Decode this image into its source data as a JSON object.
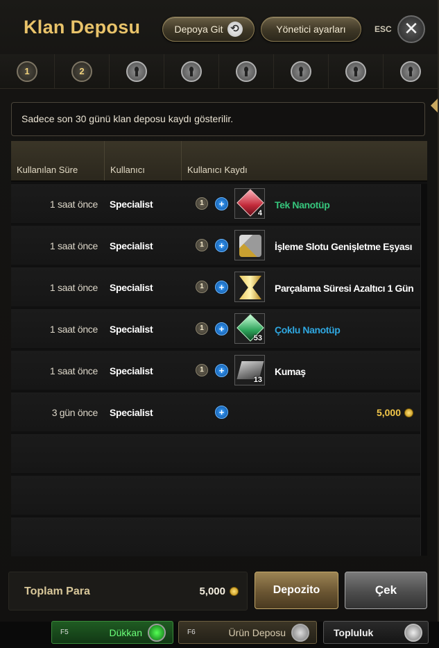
{
  "header": {
    "title": "Klan Deposu",
    "go_depot_label": "Depoya Git",
    "admin_label": "Yönetici ayarları",
    "esc_label": "ESC"
  },
  "tabs": [
    {
      "label": "1",
      "locked": false
    },
    {
      "label": "2",
      "locked": false
    },
    {
      "label": "",
      "locked": true
    },
    {
      "label": "",
      "locked": true
    },
    {
      "label": "",
      "locked": true
    },
    {
      "label": "",
      "locked": true
    },
    {
      "label": "",
      "locked": true
    },
    {
      "label": "",
      "locked": true
    }
  ],
  "notice": "Sadece son 30 günü klan deposu kaydı gösterilir.",
  "table": {
    "columns": [
      "Kullanılan Süre",
      "Kullanıcı",
      "Kullanıcı Kaydı"
    ],
    "rows": [
      {
        "time": "1 saat önce",
        "user": "Specialist",
        "count": "1",
        "icon": "red-nanotube-icon",
        "qty": "4",
        "item": "Tek Nanotüp",
        "color": "green"
      },
      {
        "time": "1 saat önce",
        "user": "Specialist",
        "count": "1",
        "icon": "tools-icon",
        "qty": "",
        "item": "İşleme Slotu Genişletme Eşyası",
        "color": "white"
      },
      {
        "time": "1 saat önce",
        "user": "Specialist",
        "count": "1",
        "icon": "hourglass-icon",
        "qty": "",
        "item": "Parçalama Süresi Azaltıcı 1 Gün",
        "color": "white"
      },
      {
        "time": "1 saat önce",
        "user": "Specialist",
        "count": "1",
        "icon": "green-nanotube-icon",
        "qty": "53",
        "item": "Çoklu Nanotüp",
        "color": "blue"
      },
      {
        "time": "1 saat önce",
        "user": "Specialist",
        "count": "1",
        "icon": "cloth-icon",
        "qty": "13",
        "item": "Kumaş",
        "color": "white"
      },
      {
        "time": "3 gün önce",
        "user": "Specialist",
        "count": "",
        "icon": "",
        "qty": "",
        "item": "",
        "money": "5,000"
      }
    ],
    "empty_rows": 3
  },
  "footer": {
    "total_label": "Toplam Para",
    "total_value": "5,000",
    "deposit_label": "Depozito",
    "withdraw_label": "Çek"
  },
  "bottom_bar": {
    "shop_key": "F5",
    "shop_label": "Dükkan",
    "depot_key": "F6",
    "depot_label": "Ürün Deposu",
    "community_label": "Topluluk"
  },
  "colors": {
    "title_gold": "#e9c36a",
    "item_green": "#36c57c",
    "item_blue": "#2fa7e0",
    "money_gold": "#f4c84a"
  }
}
